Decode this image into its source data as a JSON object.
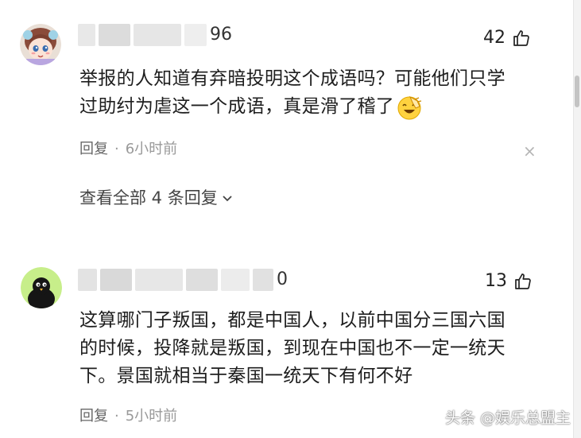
{
  "comments": [
    {
      "user_suffix": "96",
      "likes": "42",
      "text_line1": "举报的人知道有弃暗投明这个成语吗？可能他们只学",
      "text_line2": "过助纣为虐这一个成语，真是滑了稽了",
      "reply_label": "回复",
      "separator": "·",
      "time": "6小时前",
      "close_symbol": "×",
      "view_all_replies": "查看全部 4 条回复"
    },
    {
      "user_suffix": "0",
      "likes": "13",
      "text_line1": "这算哪门子叛国，都是中国人，以前中国分三国六国",
      "text_line2": "的时候，投降就是叛国，到现在中国也不一定一统天",
      "text_line3": "下。景国就相当于秦国一统天下有何不好",
      "reply_label": "回复",
      "separator": "·",
      "time": "5小时前"
    }
  ],
  "watermark": "头条 @娱乐总盟主",
  "icons": {
    "like": "thumbs-up-icon",
    "emoji": "facepalm-laugh-emoji",
    "chevron": "chevron-down-icon"
  }
}
